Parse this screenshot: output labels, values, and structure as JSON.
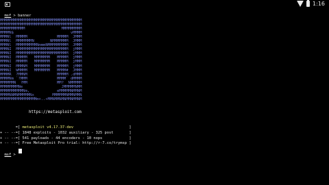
{
  "status_bar": {
    "time": "1:16",
    "icons": [
      "image-icon",
      "wifi-icon",
      "battery-icon"
    ]
  },
  "terminal": {
    "prompt_label": "msf",
    "prompt_symbol": ">",
    "command": "banner",
    "banner_lines": [
      "MMMMMMMMMMMMMMMMMMMMMMMMMMMMMMMMMMMM",
      "MMMMMMMMMMMMMMMMMMMMMMMMMMMMMMMMMMMM",
      "MMMMMMMMMMM                MMMMMMMMM",
      "MMMMN$                         vMMMM",
      "MMMNl  MMMMM             MMMMM  JMMM",
      "MMMNl  MMMMMMMN       NMMMMMMM  JMMM",
      "MMMNl  MMMMMMMMMNmmmNMMMMMMMMM  JMMM",
      "MMMNI  MMMMMMMMMMMMMMMMMMMMMMM  jMMM",
      "MMMNI  MMMMMMMMMMMMMMMMMMMMMMM  jMMM",
      "MMMNI  MMMMM   MMMMMMM   MMMMM  jMMM",
      "MMMNI  MMMMM   MMMMMMM   MMMMM  jMMM",
      "MMMNI  MMMNM   MMMMMMM   MMMMM  jMMM",
      "MMMNI  WMMMM   MMMMMMM   MMMM#  JMMM",
      "MMMMR  ?MMNM             MMMMM .dMMM",
      "MMMMNm `?MMM             MMMM` dMMMM",
      "MMMMMMN  ?MM             MM?  NMMMMM",
      "MMMMMMMMNe                 JMMMMMNMM",
      "MMMMMMMMMMNm,            eMMMMMNMMNM",
      "MMMMNNMNMMMMMNx        MMMMMMNMMNMMN",
      "MMMMMMMMMMMMMMMMm+..+MMNMMNMNMMNMMNM"
    ],
    "url": "https://metasploit.com",
    "info_lines": [
      {
        "prefix": "       =[ ",
        "text": "metasploit v4.17.37-dev",
        "suffix": "                         ]"
      },
      {
        "prefix": "+ -- --=[ ",
        "text": "1848 exploits - 1032 auxiliary - 325 post",
        "suffix": "       ]"
      },
      {
        "prefix": "+ -- --=[ ",
        "text": "541 payloads - 44 encoders - 10 nops",
        "suffix": "            ]"
      },
      {
        "prefix": "+ -- --=[ ",
        "text": "Free Metasploit Pro trial: http://r-7.co/trymsp",
        "suffix": " ]"
      }
    ]
  }
}
